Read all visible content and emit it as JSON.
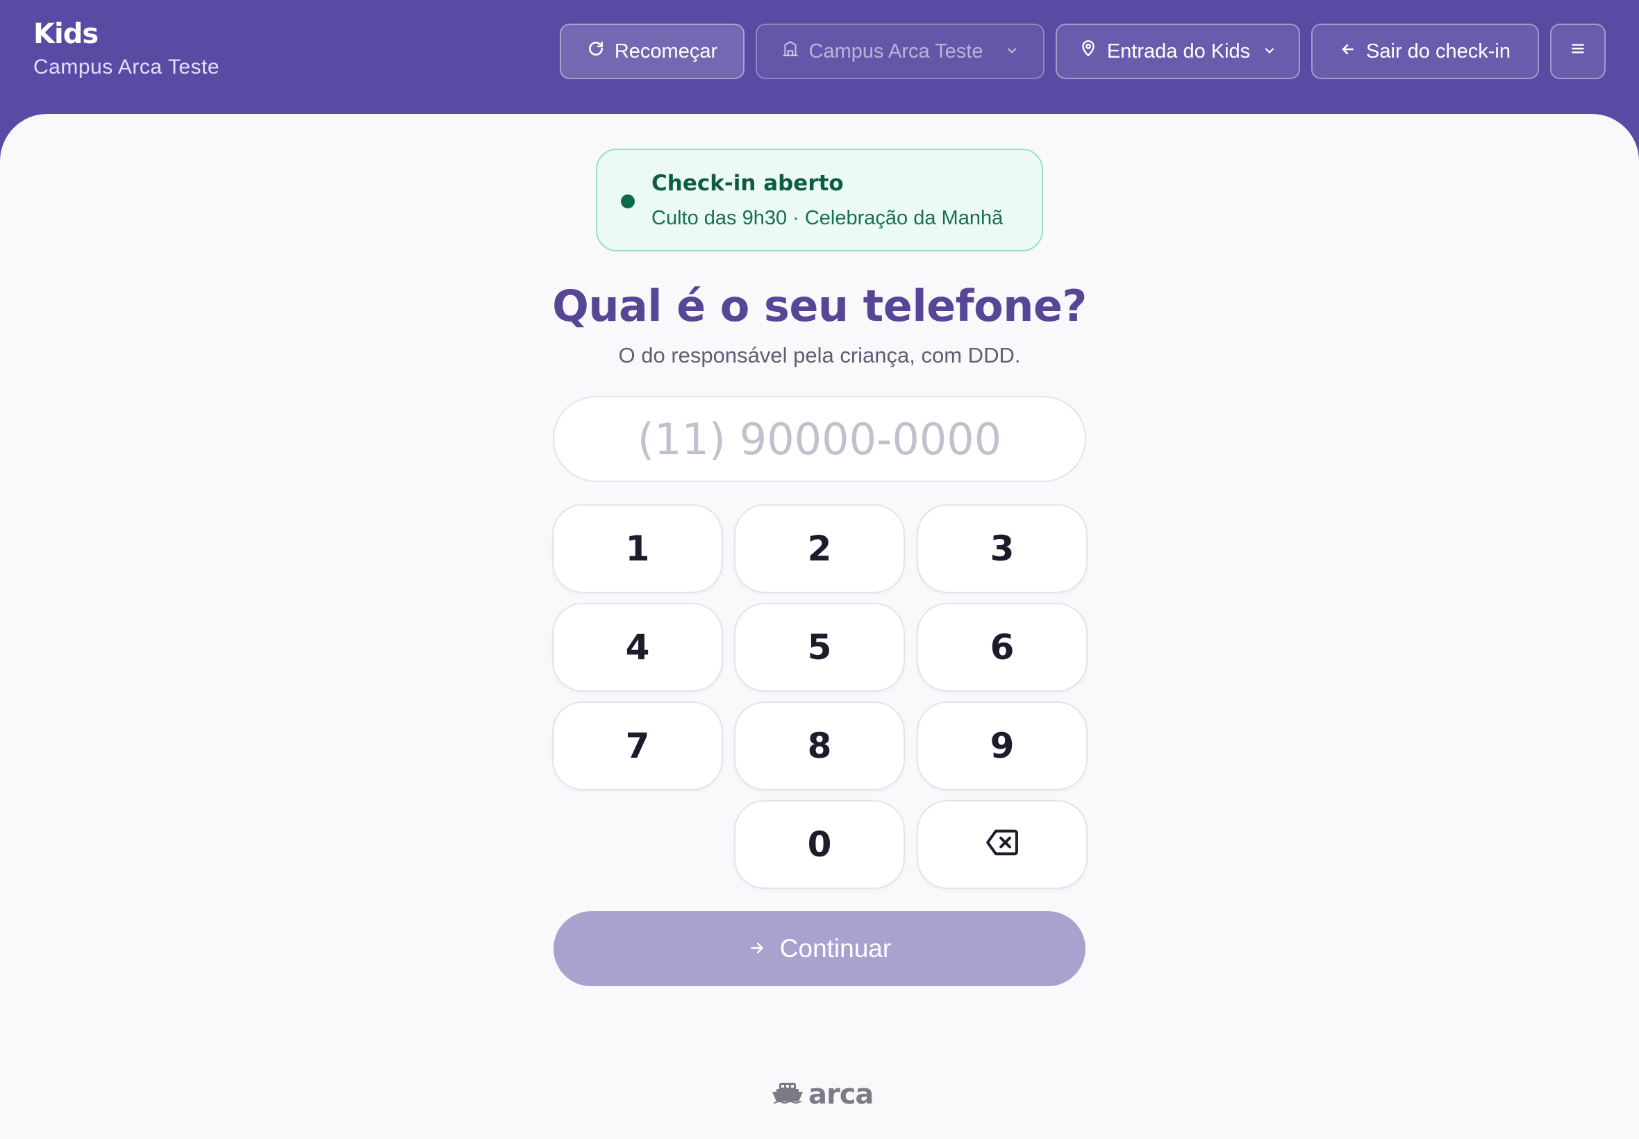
{
  "app": {
    "title": "Kids",
    "subtitle": "Campus Arca Teste"
  },
  "toolbar": {
    "restart_label": "Recomeçar",
    "campus_label": "Campus Arca Teste",
    "entrance_label": "Entrada do Kids",
    "exit_label": "Sair do check-in"
  },
  "status": {
    "title": "Check-in aberto",
    "detail": "Culto das 9h30 · Celebração da Manhã"
  },
  "prompt": {
    "question": "Qual é o seu telefone?",
    "helper": "O do responsável pela criança, com DDD."
  },
  "phone": {
    "value": "",
    "placeholder": "(11) 90000-0000"
  },
  "keypad": {
    "keys": [
      "1",
      "2",
      "3",
      "4",
      "5",
      "6",
      "7",
      "8",
      "9",
      "0"
    ]
  },
  "continue_label": "Continuar",
  "footer": {
    "brand": "arca"
  },
  "colors": {
    "header": "#5a4aa3",
    "accent_text": "#574696",
    "status_bg": "#ebfbf3",
    "status_text": "#0e5c41",
    "continue_disabled": "#a8a2cf"
  },
  "icons": {
    "restart": "refresh-icon",
    "campus": "building-icon",
    "entrance": "map-pin-icon",
    "dropdown": "chevron-down-icon",
    "exit": "arrow-left-icon",
    "menu": "hamburger-menu-icon",
    "backspace": "backspace-icon",
    "continue": "arrow-right-icon"
  }
}
